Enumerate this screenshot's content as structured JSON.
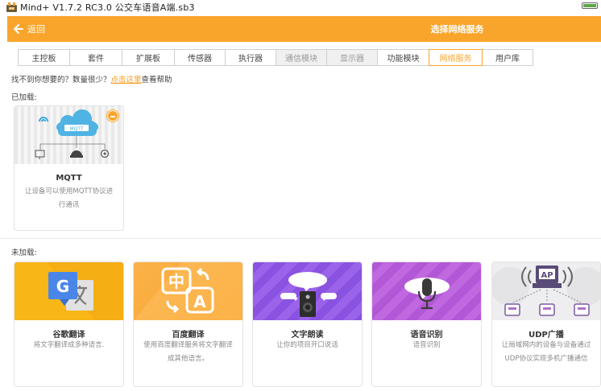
{
  "window": {
    "title": "Mind+ V1.7.2 RC3.0   公交车语音A端.sb3"
  },
  "header": {
    "back_label": "返回",
    "title": "选择网络服务"
  },
  "tabs": [
    {
      "label": "主控板",
      "state": "normal"
    },
    {
      "label": "套件",
      "state": "normal"
    },
    {
      "label": "扩展板",
      "state": "normal"
    },
    {
      "label": "传感器",
      "state": "normal"
    },
    {
      "label": "执行器",
      "state": "normal"
    },
    {
      "label": "通信模块",
      "state": "disabled"
    },
    {
      "label": "显示器",
      "state": "disabled"
    },
    {
      "label": "功能模块",
      "state": "normal"
    },
    {
      "label": "网络服务",
      "state": "active"
    },
    {
      "label": "用户库",
      "state": "normal"
    }
  ],
  "help": {
    "prefix": "找不到你想要的？数量很少？",
    "link": "点击这里",
    "suffix": "查看帮助"
  },
  "loaded": {
    "label": "已加载:",
    "items": [
      {
        "name": "MQTT",
        "desc_line1": "让设备可以使用MQTT协议进",
        "desc_line2": "行通讯",
        "banner_text": "MQTT"
      }
    ]
  },
  "unloaded": {
    "label": "未加载:",
    "items": [
      {
        "name": "谷歌翻译",
        "desc_line1": "将文字翻译成多种语言.",
        "desc_line2": ""
      },
      {
        "name": "百度翻译",
        "desc_line1": "使用百度翻译服务将文字翻译",
        "desc_line2": "成其他语言。",
        "glyph1": "中",
        "glyph2": "A"
      },
      {
        "name": "文字朗读",
        "desc_line1": "让你的项目开口说话",
        "desc_line2": ""
      },
      {
        "name": "语音识别",
        "desc_line1": "语音识别",
        "desc_line2": ""
      },
      {
        "name": "UDP广播",
        "desc_line1": "让局域网内的设备与设备通过",
        "desc_line2": "UDP协议实现多机广播通信",
        "banner_text": "AP"
      }
    ]
  },
  "colors": {
    "accent": "#f9a52b",
    "google": "#f8b617",
    "baidu": "#fbaa3c",
    "tts": "#8d55e3",
    "speech": "#b55ad9",
    "udp": "#ecebec"
  }
}
